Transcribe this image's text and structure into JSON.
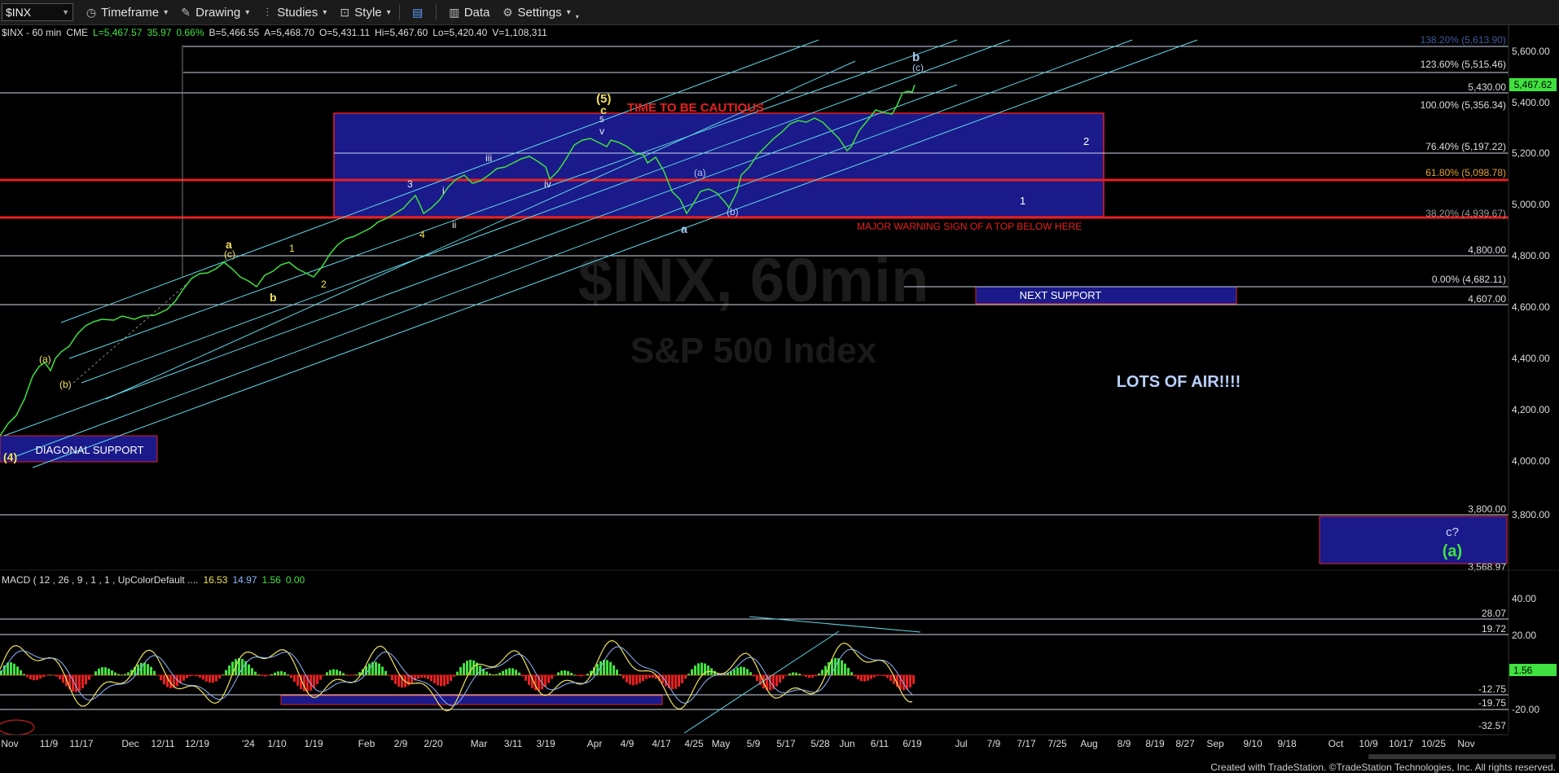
{
  "toolbar": {
    "symbol": "$INX",
    "items": [
      "Timeframe",
      "Drawing",
      "Studies",
      "Style",
      "Data",
      "Settings"
    ]
  },
  "infobar": {
    "symbol": "$INX - 60 min",
    "exchange": "CME",
    "last": "L=5,467.57",
    "change": "35.97",
    "pct": "0.66%",
    "bid": "B=5,466.55",
    "ask": "A=5,468.70",
    "open": "O=5,431.11",
    "high": "Hi=5,467.60",
    "low": "Lo=5,420.40",
    "volume": "V=1,108,311"
  },
  "macd_header": {
    "label": "MACD ( 12 , 26 , 9 , 1 , 1 , UpColorDefault ....",
    "v1": "16.53",
    "v2": "14.97",
    "v3": "1.56",
    "v4": "0.00"
  },
  "colors": {
    "price_up": "#3fe23f",
    "wave_yellow": "#f1e35a",
    "box_blue": "#1a1a8a",
    "red_line": "#e82020",
    "channel": "#5fd6e6"
  },
  "price_scale": [
    "5,600.00",
    "5,400.00",
    "5,200.00",
    "5,000.00",
    "4,800.00",
    "4,600.00",
    "4,400.00",
    "4,200.00",
    "4,000.00",
    "3,800.00"
  ],
  "level_labels": {
    "l5430": "5,430.00",
    "l4800": "4,800.00",
    "l4607": "4,607.00",
    "l3800": "3,800.00",
    "l3568": "3,568.97",
    "current": "5,467.62"
  },
  "fibs": [
    "123.60% (5,515.46)",
    "100.00% (5,356.34)",
    "76.40% (5,197.22)",
    "61.80% (5,098.78)",
    "38.20% (4,939.67)",
    "0.00% (4,682.11)",
    "138.20% (5,613.90)"
  ],
  "macd_scale": [
    "40.00",
    "20.00",
    "-20.00"
  ],
  "macd_levels": [
    "28.07",
    "19.72",
    "-12.75",
    "-19.75",
    "-32.57",
    "1.56"
  ],
  "annotations": {
    "caution": "TIME TO BE CAUTIOUS",
    "warning": "MAJOR WARNING SIGN OF A TOP BELOW HERE",
    "next_support": "NEXT SUPPORT",
    "diagonal_support": "DIAGONAL SUPPORT",
    "air": "LOTS OF AIR!!!!",
    "box1": "1",
    "box2": "2",
    "c_q": "c?",
    "a_paren": "(a)",
    "watermark_1": "$INX, 60min",
    "watermark_2": "S&P 500 Index"
  },
  "waves": {
    "w4": "(4)",
    "wa_paren": "(a)",
    "wb_paren": "(b)",
    "wa": "a",
    "wc_paren": "(c)",
    "wb": "b",
    "w1": "1",
    "w2": "2",
    "w3": "3",
    "w4s": "4",
    "wi": "i",
    "wii": "ii",
    "wiii": "iii",
    "wiv": "iv",
    "wv": "v",
    "w5": "(5)",
    "wc": "c",
    "w5s": "5",
    "ba": "a",
    "b_a_paren": "(a)",
    "b_b_paren": "(b)",
    "top_b": "b",
    "top_c_paren": "(c)"
  },
  "x_axis": [
    "Nov",
    "11/9",
    "11/17",
    "Dec",
    "12/11",
    "12/19",
    "'24",
    "1/10",
    "1/19",
    "Feb",
    "2/9",
    "2/20",
    "Mar",
    "3/11",
    "3/19",
    "Apr",
    "4/9",
    "4/17",
    "4/25",
    "May",
    "5/9",
    "5/17",
    "5/28",
    "Jun",
    "6/11",
    "6/19",
    "Jul",
    "7/9",
    "7/17",
    "7/25",
    "Aug",
    "8/9",
    "8/19",
    "8/27",
    "Sep",
    "9/10",
    "9/18",
    "Oct",
    "10/9",
    "10/17",
    "10/25",
    "Nov"
  ],
  "footer": "Created with TradeStation. ©TradeStation Technologies, Inc. All rights reserved."
}
